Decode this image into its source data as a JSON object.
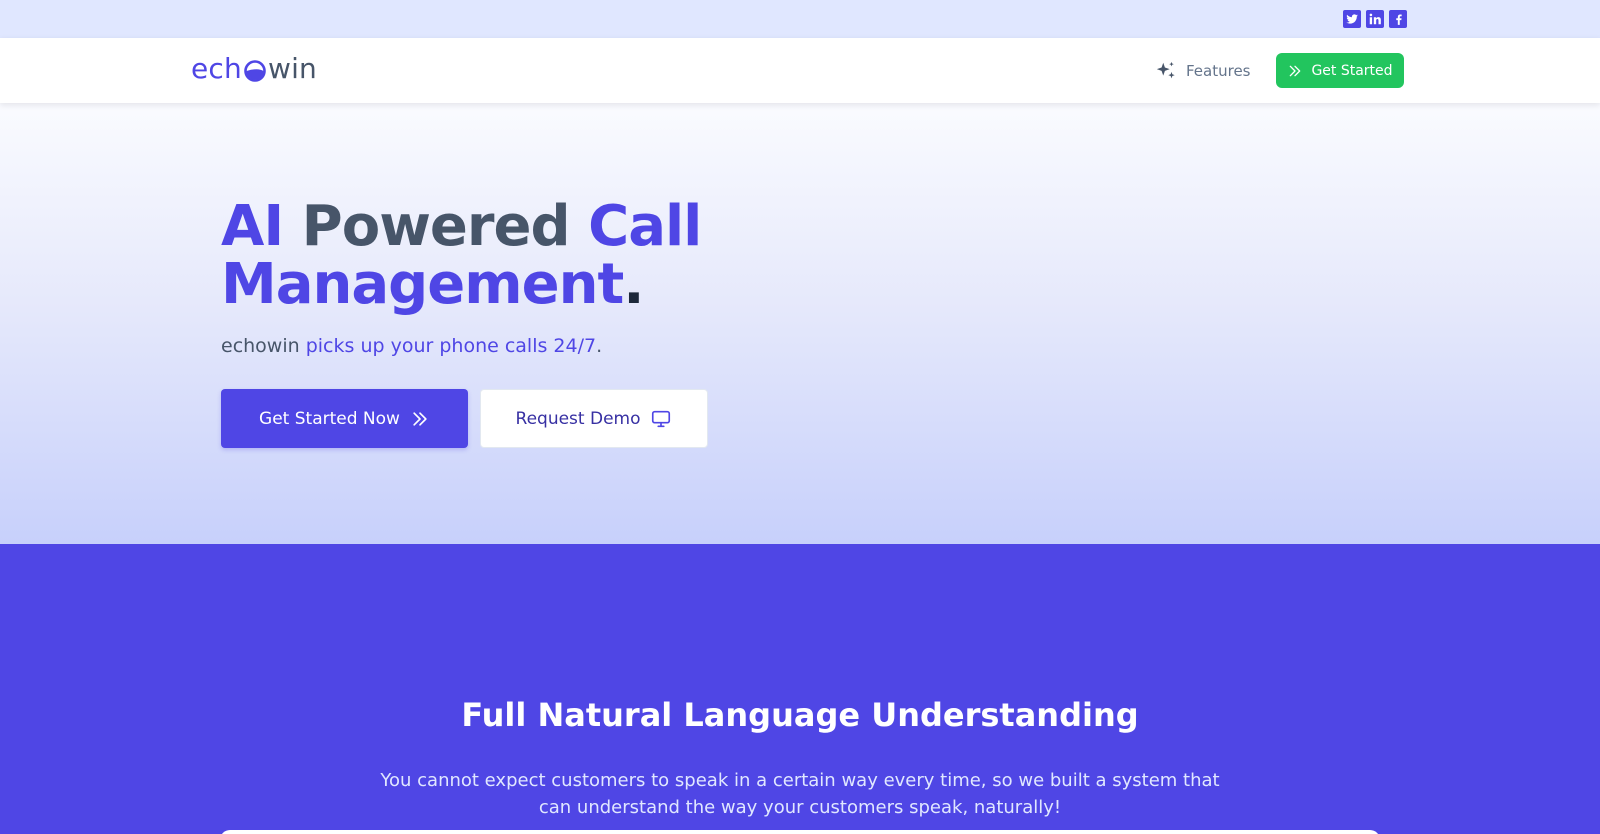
{
  "social": {
    "icons": [
      "twitter-icon",
      "linkedin-icon",
      "facebook-icon"
    ]
  },
  "header": {
    "logo_prefix": "ech",
    "logo_suffix": "win",
    "features_label": "Features",
    "cta_label": "Get Started"
  },
  "hero": {
    "title_word_1": "AI",
    "title_word_2": " Powered ",
    "title_word_3": "Call",
    "title_word_4": "Management",
    "title_period": ".",
    "subtitle_brand": "echowin",
    "subtitle_highlight": " picks up your phone calls 24/7",
    "subtitle_period": ".",
    "primary_button": "Get Started Now",
    "secondary_button": "Request Demo"
  },
  "features": {
    "title": "Full Natural Language Understanding",
    "description": "You cannot expect customers to speak in a certain way every time, so we built a system that can understand the way your customers speak, naturally!"
  },
  "colors": {
    "brand": "#4f46e5",
    "cta_green": "#22c55e",
    "topbar": "#e0e7ff"
  }
}
